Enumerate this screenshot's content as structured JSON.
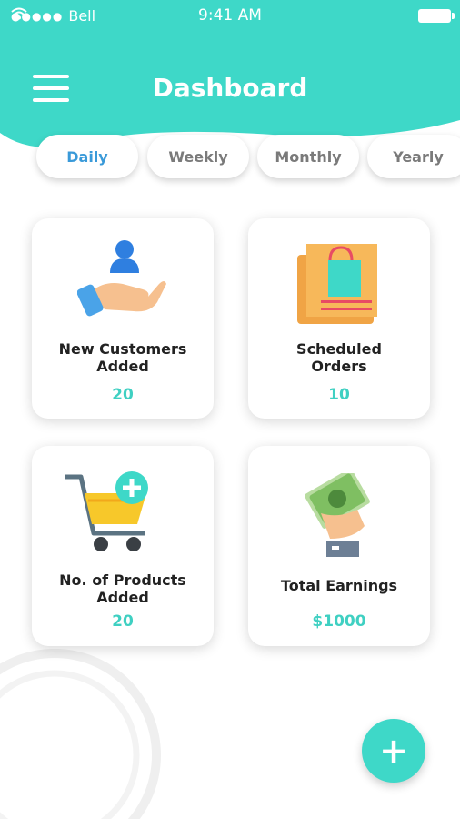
{
  "colors": {
    "accent": "#3ed8c8",
    "active_tab": "#3a9ad9",
    "value": "#3fd0c2"
  },
  "status_bar": {
    "carrier": "Bell",
    "time": "9:41 AM"
  },
  "header": {
    "title": "Dashboard",
    "menu_icon": "hamburger-menu-icon"
  },
  "tabs": [
    {
      "label": "Daily",
      "active": true
    },
    {
      "label": "Weekly",
      "active": false
    },
    {
      "label": "Monthly",
      "active": false
    },
    {
      "label": "Yearly",
      "active": false
    }
  ],
  "cards": [
    {
      "label": "New Customers Added",
      "value": "20",
      "icon": "customer-hand-icon"
    },
    {
      "label": "Scheduled Orders",
      "value": "10",
      "icon": "shopping-bag-icon"
    },
    {
      "label": "No. of Products Added",
      "value": "20",
      "icon": "cart-add-icon"
    },
    {
      "label": "Total Earnings",
      "value": "$1000",
      "icon": "cash-hand-icon"
    }
  ],
  "fab": {
    "label": "+",
    "icon": "plus-icon"
  }
}
